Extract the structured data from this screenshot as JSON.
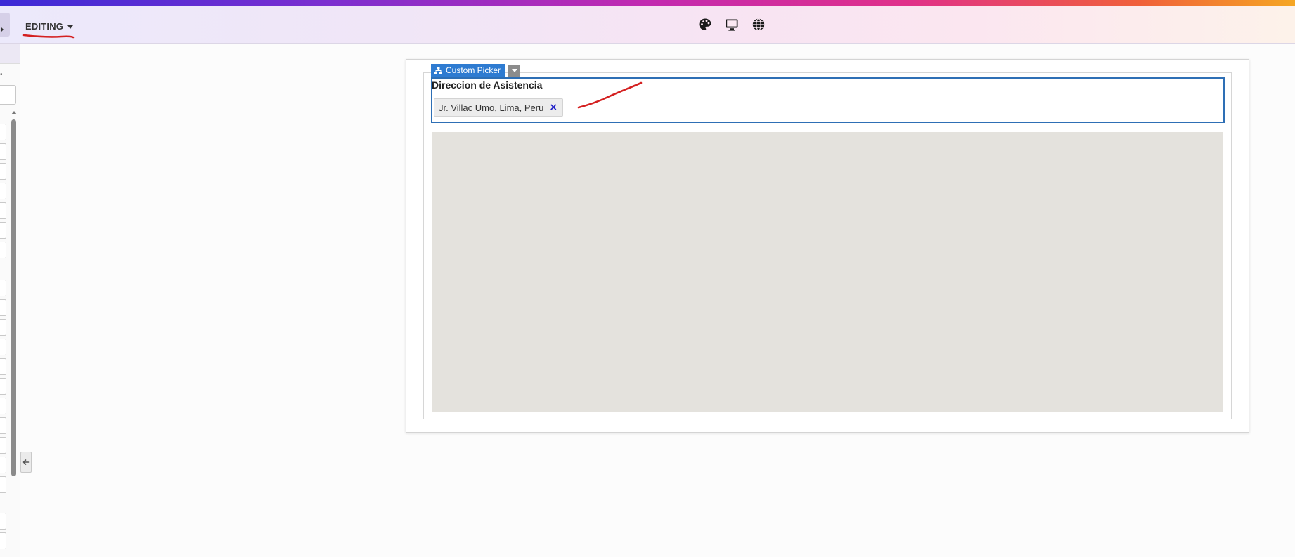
{
  "toolbar": {
    "mode_label": "EDITING",
    "icons": [
      "palette-icon",
      "monitor-icon",
      "globe-icon"
    ]
  },
  "colors": {
    "accent": "#2e7bd1",
    "field_border": "#2e6fb5",
    "annotation": "#d42020",
    "map_fill": "#e4e2dd"
  },
  "component": {
    "badge_label": "Custom Picker",
    "field_label": "Direccion de Asistencia",
    "selected_value": "Jr. Villac Umo, Lima, Peru",
    "remove_glyph": "×"
  }
}
